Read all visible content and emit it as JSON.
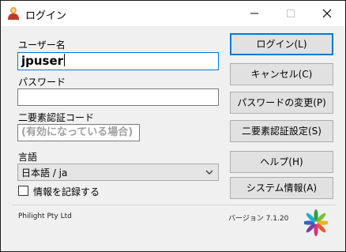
{
  "window": {
    "title": "ログイン",
    "minimize_icon": "minimize-icon",
    "maximize_icon": "maximize-icon",
    "close_icon": "close-icon"
  },
  "form": {
    "username_label": "ユーザー名",
    "username_value": "jpuser",
    "password_label": "パスワード",
    "password_value": "",
    "twofactor_label": "二要素認証コード",
    "twofactor_placeholder": "(有効になっている場合)",
    "language_label": "言語",
    "language_selected": "日本語 / ja",
    "remember_label": "情報を記録する",
    "remember_checked": false
  },
  "buttons": {
    "login": "ログイン(L)",
    "cancel": "キャンセル(C)",
    "change_password": "パスワードの変更(P)",
    "twofactor_settings": "二要素認証設定(S)",
    "help": "ヘルプ(H)",
    "system_info": "システム情報(A)"
  },
  "footer": {
    "company": "Philight Pty Ltd",
    "version": "バージョン 7.1.20",
    "logo_icon": "pinwheel-logo"
  },
  "colors": {
    "focus_blue": "#0078d7",
    "button_face": "#e1e1e1",
    "dialog_face": "#f0f0f0"
  }
}
